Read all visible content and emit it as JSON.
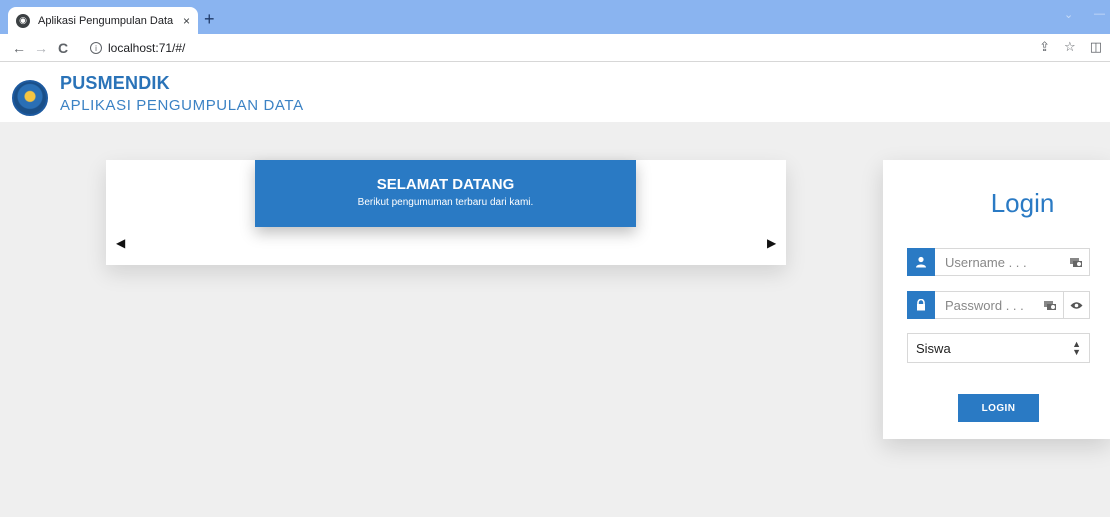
{
  "browser": {
    "tab_title": "Aplikasi Pengumpulan Data",
    "tab_close": "×",
    "new_tab": "+",
    "url": "localhost:71/#/"
  },
  "header": {
    "title": "PUSMENDIK",
    "subtitle": "APLIKASI PENGUMPULAN DATA"
  },
  "carousel": {
    "title": "SELAMAT DATANG",
    "subtitle": "Berikut pengumuman terbaru dari kami.",
    "prev_label": "◀",
    "next_label": "▶"
  },
  "login": {
    "title": "Login",
    "username_placeholder": "Username . . .",
    "password_placeholder": "Password . . .",
    "role_selected": "Siswa",
    "button_label": "LOGIN"
  },
  "colors": {
    "accent": "#2a7ac4",
    "tabstrip": "#8ab4f0",
    "background": "#efefef"
  }
}
